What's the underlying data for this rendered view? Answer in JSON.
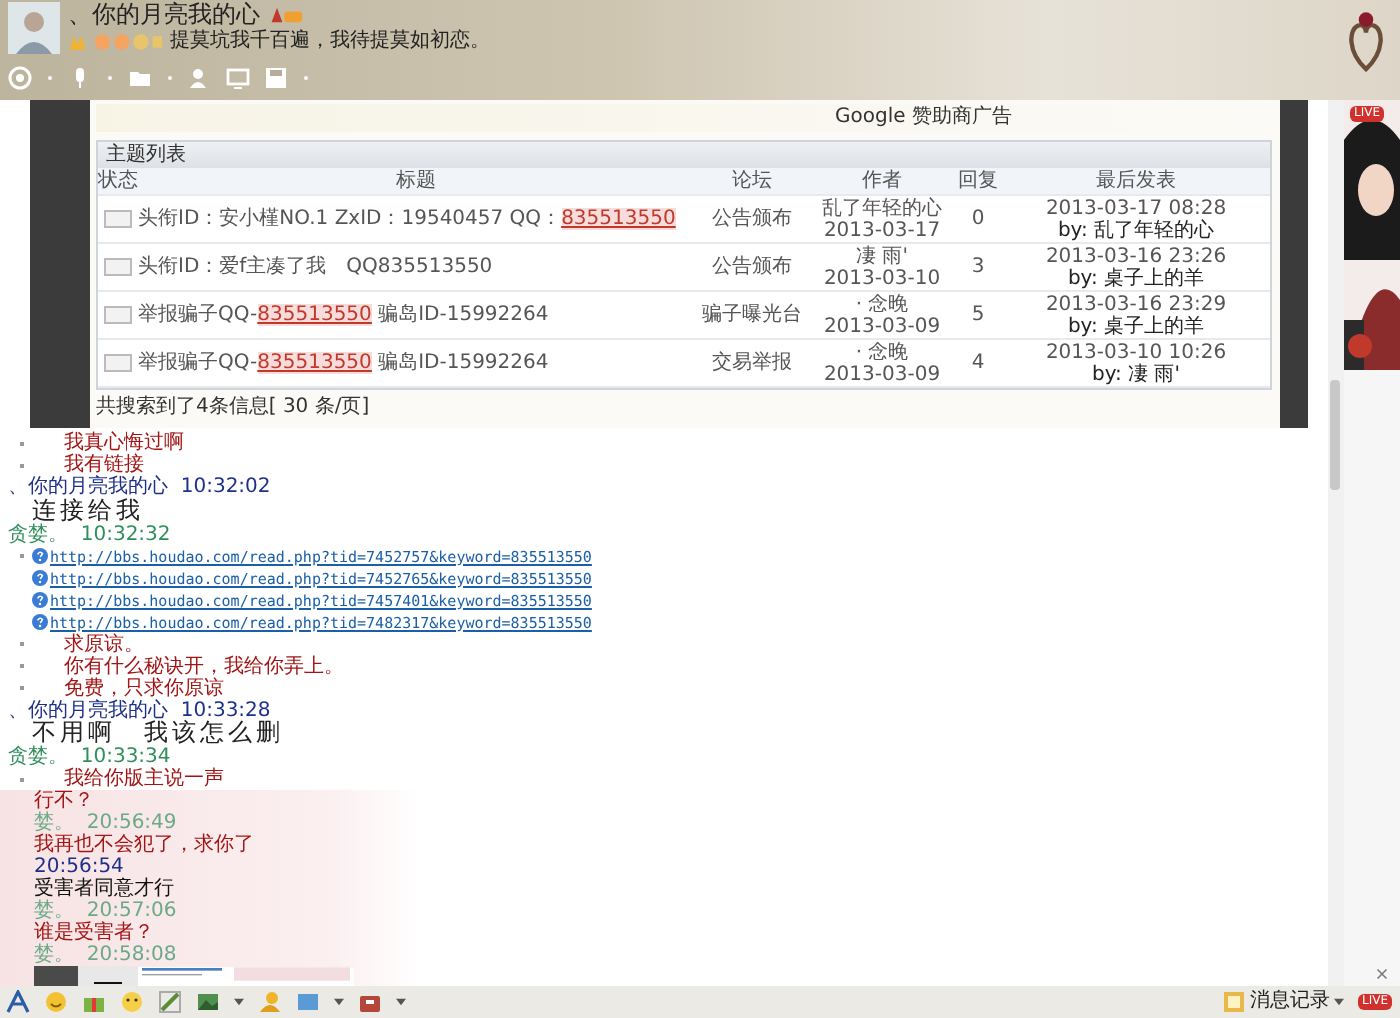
{
  "header": {
    "nickname": "、你的月亮我的心",
    "signature": "提莫坑我千百遍，我待提莫如初恋。"
  },
  "shared_page": {
    "ad_label": "Google 赞助商广告",
    "table_title": "主题列表",
    "columns": [
      "状态",
      "标题",
      "论坛",
      "作者",
      "回复",
      "最后发表"
    ],
    "rows": [
      {
        "title": [
          {
            "text": "头衔ID：安小槿NO.1 ZxID：19540457 QQ：",
            "link": false
          },
          {
            "text": "835513550",
            "link": true
          }
        ],
        "forum": "公告颁布",
        "author": "乱了年轻的心",
        "date": "2013-03-17",
        "replies": "0",
        "last_time": "2013-03-17 08:28",
        "last_by": "by: 乱了年轻的心"
      },
      {
        "title": [
          {
            "text": "头衔ID：爱f主凑了我　QQ835513550",
            "link": false
          }
        ],
        "forum": "公告颁布",
        "author": "凄 雨'",
        "date": "2013-03-10",
        "replies": "3",
        "last_time": "2013-03-16 23:26",
        "last_by": "by: 桌子上的羊"
      },
      {
        "title": [
          {
            "text": "举报骗子QQ-",
            "link": false
          },
          {
            "text": "835513550",
            "link": true
          },
          {
            "text": " 骗岛ID-15992264",
            "link": false
          }
        ],
        "forum": "骗子曝光台",
        "author": "· 念晚",
        "date": "2013-03-09",
        "replies": "5",
        "last_time": "2013-03-16 23:29",
        "last_by": "by: 桌子上的羊"
      },
      {
        "title": [
          {
            "text": "举报骗子QQ-",
            "link": false
          },
          {
            "text": "835513550",
            "link": true
          },
          {
            "text": " 骗岛ID-15992264",
            "link": false
          }
        ],
        "forum": "交易举报",
        "author": "· 念晚",
        "date": "2013-03-09",
        "replies": "4",
        "last_time": "2013-03-10 10:26",
        "last_by": "by: 凄 雨'"
      }
    ],
    "summary": "共搜索到了4条信息[ 30 条/页]"
  },
  "chat": [
    {
      "kind": "text",
      "text": "我真心悔过啊",
      "color": "#a31515",
      "large": false,
      "bullet": true,
      "highlight": false
    },
    {
      "kind": "text",
      "text": "我有链接",
      "color": "#a31515",
      "large": false,
      "bullet": true,
      "highlight": false
    },
    {
      "kind": "header",
      "name": "、你的月亮我的心",
      "time": "10:32:02",
      "own": false,
      "highlight": false
    },
    {
      "kind": "text",
      "text": "连接给我",
      "color": "#222222",
      "large": true,
      "bullet": false,
      "highlight": false
    },
    {
      "kind": "header",
      "name": "贪婪。",
      "time": "10:32:32",
      "own": true,
      "highlight": false
    },
    {
      "kind": "link",
      "url": "http://bbs.houdao.com/read.php?tid=7452757&keyword=835513550",
      "bullet": true,
      "highlight": false
    },
    {
      "kind": "link",
      "url": "http://bbs.houdao.com/read.php?tid=7452765&keyword=835513550",
      "bullet": false,
      "highlight": false
    },
    {
      "kind": "link",
      "url": "http://bbs.houdao.com/read.php?tid=7457401&keyword=835513550",
      "bullet": false,
      "highlight": false
    },
    {
      "kind": "link",
      "url": "http://bbs.houdao.com/read.php?tid=7482317&keyword=835513550",
      "bullet": false,
      "highlight": false
    },
    {
      "kind": "text",
      "text": "求原谅。",
      "color": "#a31515",
      "large": false,
      "bullet": true,
      "highlight": false
    },
    {
      "kind": "text",
      "text": "你有什么秘诀开，我给你弄上。",
      "color": "#a31515",
      "large": false,
      "bullet": true,
      "highlight": false
    },
    {
      "kind": "text",
      "text": "免费，只求你原谅",
      "color": "#a31515",
      "large": false,
      "bullet": true,
      "highlight": false
    },
    {
      "kind": "header",
      "name": "、你的月亮我的心",
      "time": "10:33:28",
      "own": false,
      "highlight": false
    },
    {
      "kind": "text",
      "text": "不用啊　我该怎么删",
      "color": "#222222",
      "large": true,
      "bullet": false,
      "highlight": false
    },
    {
      "kind": "header",
      "name": "贪婪。",
      "time": "10:33:34",
      "own": true,
      "highlight": false
    },
    {
      "kind": "text",
      "text": "我给你版主说一声",
      "color": "#a31515",
      "large": false,
      "bullet": true,
      "highlight": false
    },
    {
      "kind": "text",
      "text": "行不？",
      "color": "#a31515",
      "large": false,
      "bullet": false,
      "highlight": true
    },
    {
      "kind": "header",
      "name": "婪。",
      "time": "20:56:49",
      "own": true,
      "highlight": true
    },
    {
      "kind": "text",
      "text": "我再也不会犯了，求你了",
      "color": "#a31515",
      "large": false,
      "bullet": false,
      "highlight": true
    },
    {
      "kind": "header",
      "time": "20:56:54",
      "own": false,
      "highlight": true
    },
    {
      "kind": "text",
      "text": "受害者同意才行",
      "color": "#111111",
      "large": false,
      "bullet": false,
      "highlight": true
    },
    {
      "kind": "header",
      "name": "婪。",
      "time": "20:57:06",
      "own": true,
      "highlight": true
    },
    {
      "kind": "text",
      "text": "谁是受害者？",
      "color": "#a31515",
      "large": false,
      "bullet": false,
      "highlight": true
    },
    {
      "kind": "header",
      "name": "婪。",
      "time": "20:58:08",
      "own": true,
      "highlight": true
    },
    {
      "kind": "screenshot",
      "highlight": true
    }
  ],
  "side_panel": {
    "badge": "LIVE"
  },
  "footer": {
    "history_button": "消息记录",
    "badge": "LIVE"
  }
}
